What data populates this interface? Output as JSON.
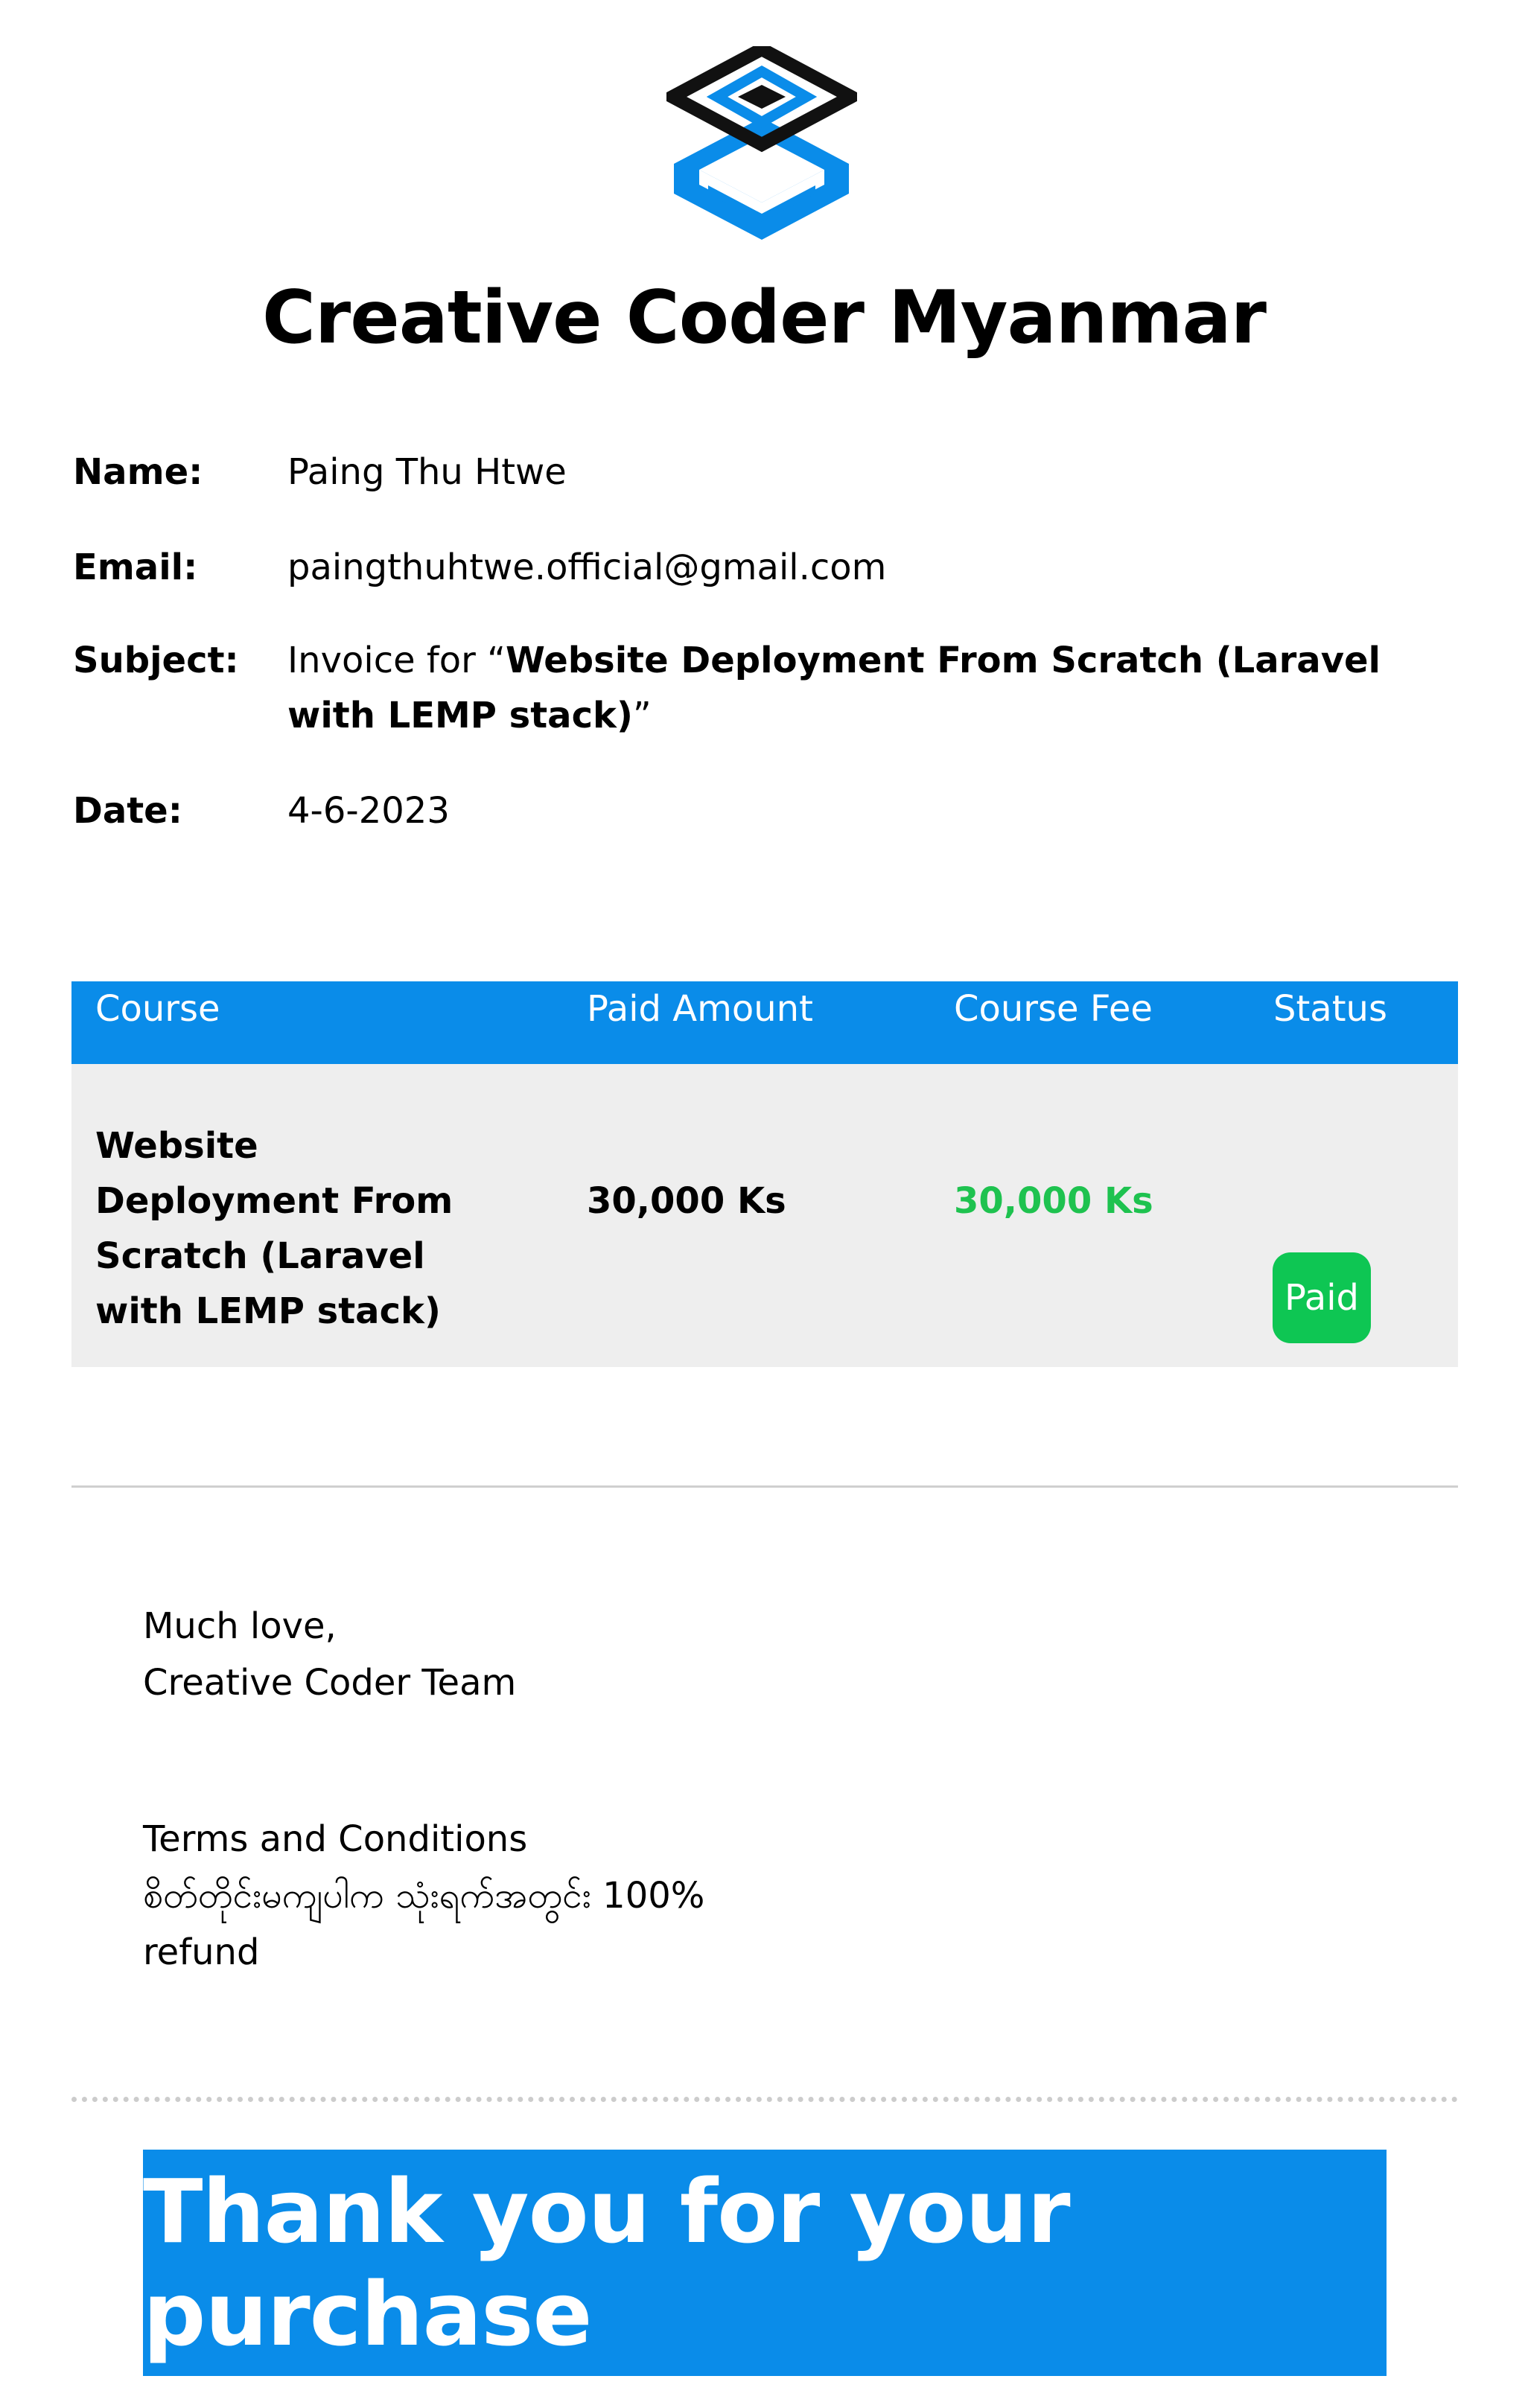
{
  "company": {
    "name": "Creative Coder Myanmar"
  },
  "info": {
    "name_label": "Name:",
    "name_value": "Paing Thu Htwe",
    "email_label": "Email:",
    "email_value": "paingthuhtwe.official@gmail.com",
    "subject_label": "Subject:",
    "subject_prefix": "Invoice for “",
    "subject_course": "Website Deployment From Scratch (Laravel with LEMP stack)",
    "subject_suffix": "”",
    "date_label": "Date:",
    "date_value": "4-6-2023"
  },
  "table": {
    "headers": [
      "Course",
      "Paid Amount",
      "Course Fee",
      "Status"
    ],
    "row": {
      "course": "Website Deployment From Scratch (Laravel with LEMP stack)",
      "paid_amount": "30,000 Ks",
      "course_fee": "30,000 Ks",
      "status": "Paid"
    }
  },
  "signoff": {
    "line1": "Much love,",
    "line2": "Creative Coder Team"
  },
  "terms": {
    "title": "Terms and Conditions",
    "text": "စိတ်တိုင်းမကျပါက သုံးရက်အတွင်း 100% refund"
  },
  "footer": {
    "thanks": "Thank you for your purchase"
  },
  "colors": {
    "accent": "#0a8ce9",
    "paid_green": "#0ec653",
    "fee_green": "#1ec24f",
    "row_bg": "#eeeeee",
    "logo_dark": "#111111"
  },
  "icons": {
    "logo": "creative-coder-logo-icon"
  }
}
